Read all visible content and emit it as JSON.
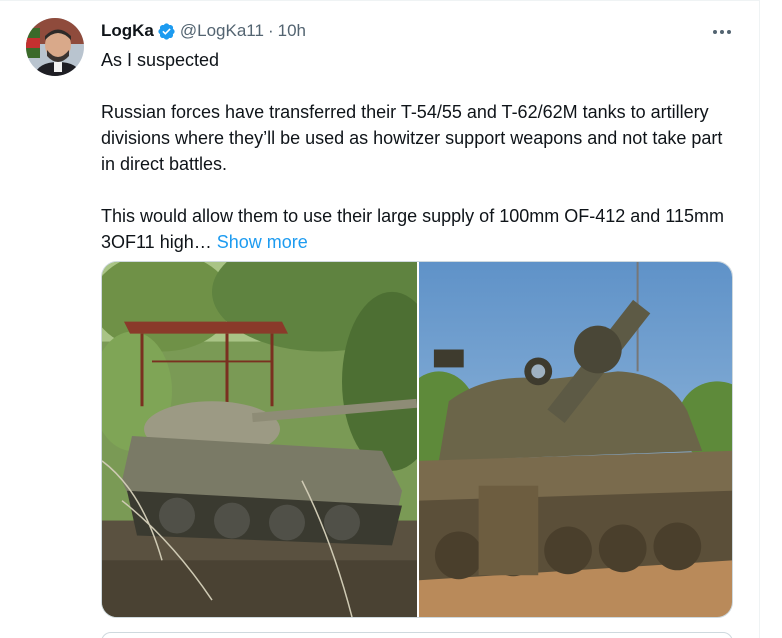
{
  "tweet": {
    "author_name": "LogKa",
    "author_handle": "@LogKa11",
    "separator": "·",
    "time": "10h",
    "text_lines": [
      "As I suspected",
      "Russian forces have transferred their T-54/55 and T-62/62M tanks to artillery divisions where they’ll be used as howitzer support weapons and not take part in direct battles.",
      "This would allow them to use their large supply of 100mm OF-412 and 115mm 3OF11 high…"
    ],
    "show_more_label": "Show more"
  },
  "colors": {
    "accent": "#1d9bf0",
    "text": "#0f1419",
    "secondary": "#536471",
    "border": "#cfd9de"
  },
  "icons": {
    "verified": "verified-badge-icon",
    "more": "more-horizontal-icon"
  }
}
